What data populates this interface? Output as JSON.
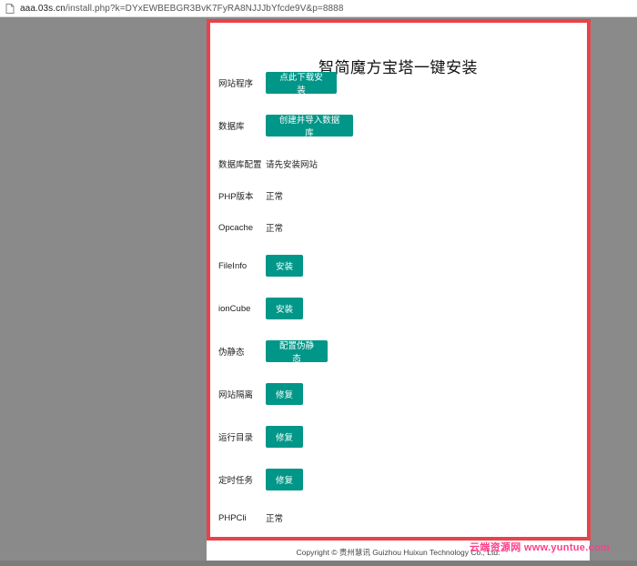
{
  "browser": {
    "url_host": "aaa.03s.cn",
    "url_path": "/install.php?k=DYxEWBEBGR3BvK7FyRA8NJJJbYfcde9V&p=8888"
  },
  "page": {
    "title": "智简魔方宝塔一键安装",
    "footer": "Copyright © 贵州慧讯 Guizhou Huixun Technology Co., Ltd.",
    "watermark": "云端资源网 www.yuntue.com"
  },
  "rows": [
    {
      "label": "网站程序",
      "button": "点此下载安装"
    },
    {
      "label": "数据库",
      "button": "创建并导入数据库"
    },
    {
      "label": "数据库配置",
      "value": "请先安装网站"
    },
    {
      "label": "PHP版本",
      "value": "正常"
    },
    {
      "label": "Opcache",
      "value": "正常"
    },
    {
      "label": "FileInfo",
      "button": "安装"
    },
    {
      "label": "ionCube",
      "button": "安装"
    },
    {
      "label": "伪静态",
      "button": "配置伪静态"
    },
    {
      "label": "网站隔离",
      "button": "修复"
    },
    {
      "label": "运行目录",
      "button": "修复"
    },
    {
      "label": "定时任务",
      "button": "修复"
    },
    {
      "label": "PHPCli",
      "value": "正常"
    }
  ],
  "colors": {
    "button": "#009688",
    "frame": "#e8434a",
    "watermark": "#ff3d8a",
    "backdrop": "#8a8a8a"
  }
}
